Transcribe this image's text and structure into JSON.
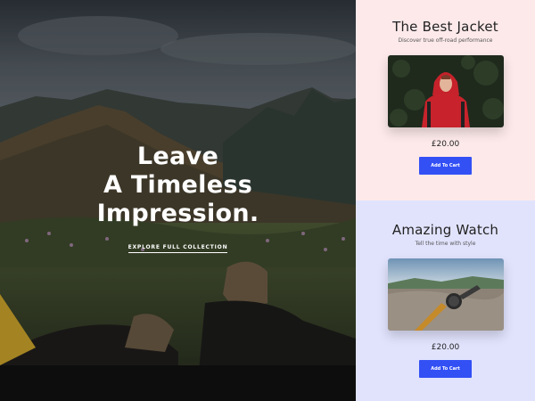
{
  "hero": {
    "headline_lines": [
      "Leave",
      "A Timeless",
      "Impression."
    ],
    "cta_label": "EXPLORE FULL COLLECTION",
    "text_color": "#ffffff"
  },
  "products": [
    {
      "title": "The Best Jacket",
      "subtitle": "Discover true off-road performance",
      "price": "£20.00",
      "button_label": "Add To Cart",
      "image": "person-in-red-jacket-photo",
      "background": "#fde9ea"
    },
    {
      "title": "Amazing Watch",
      "subtitle": "Tell the time with style",
      "price": "£20.00",
      "button_label": "Add To Cart",
      "image": "watch-on-rock-photo",
      "background": "#e1e3fd"
    }
  ],
  "colors": {
    "accent_button": "#3350f5"
  }
}
